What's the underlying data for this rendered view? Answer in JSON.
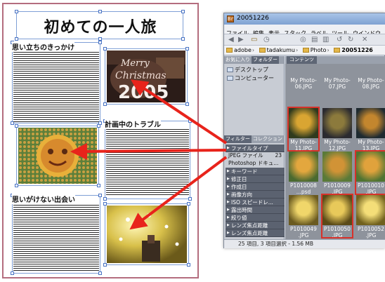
{
  "layout_page": {
    "title": "初めての一人旅",
    "headings": [
      "思い立ちのきっかけ",
      "計画中のトラブル",
      "思いがけない出会い"
    ],
    "photos": [
      "merry-christmas-2005-photo",
      "sunflower-face-photo",
      "light-show-photo"
    ],
    "photo_text": "Merry Christmas 2005"
  },
  "bridge": {
    "window_title": "20051226",
    "app_icon": "Br",
    "menu": [
      "ファイル",
      "編集",
      "表示",
      "スタック",
      "ラベル",
      "ツール",
      "ウインドウ"
    ],
    "path": [
      "adobe",
      "tadakumu",
      "Photo",
      "20051226"
    ],
    "panel_tabs": [
      "お気に入り",
      "フォルダー"
    ],
    "nav_items": [
      "デスクトップ",
      "コンピューター"
    ],
    "filter_tabs": [
      "フィルター",
      "コレクション"
    ],
    "filter_rows": [
      {
        "label": "ファイルタイプ",
        "kind": "cat"
      },
      {
        "label": "JPEG ファイル",
        "count": "23",
        "kind": "plain"
      },
      {
        "label": "Photoshop ドキュ...",
        "count": "",
        "kind": "plain"
      },
      {
        "label": "キーワード",
        "kind": "cat"
      },
      {
        "label": "修正日",
        "kind": "cat"
      },
      {
        "label": "作成日",
        "kind": "cat"
      },
      {
        "label": "画像方向",
        "kind": "cat"
      },
      {
        "label": "ISO スピードレ...",
        "kind": "cat"
      },
      {
        "label": "露出時間",
        "kind": "cat"
      },
      {
        "label": "絞り値",
        "kind": "cat"
      },
      {
        "label": "レンズ焦点距離",
        "kind": "cat"
      },
      {
        "label": "レンズ焦点距離",
        "kind": "cat"
      }
    ],
    "content_tab": "コンテンツ",
    "thumb_captions": [
      "My Photo-\n06.JPG",
      "My Photo-\n07.JPG",
      "My Photo-\n08.JPG",
      "My Photo-\n11.JPG",
      "My Photo-\n12.JPG",
      "My Photo-\n13.JPG",
      "P1010008\n...psd",
      "P1010009\n.JPG",
      "P1010010\n.JPG",
      "P1010049\n.JPG",
      "P1010050\n.JPG",
      "P1010052\n.JPG"
    ],
    "status": "25 項目, 3 項目選択 - 1.56 MB"
  },
  "colors": {
    "page_border": "#b46d7e",
    "selection_red": "#d8312a",
    "arrow_red": "#e8231b",
    "frame_blue": "#7f9fd6"
  }
}
